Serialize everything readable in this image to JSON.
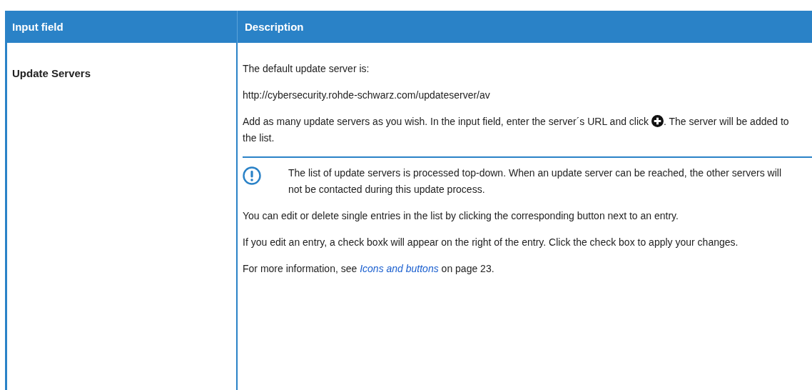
{
  "table": {
    "columns": [
      "Input field",
      "Description"
    ],
    "rows": [
      {
        "field": "Update Servers",
        "description": [
          {
            "kind": "paragraph",
            "text": "The default update server is:"
          },
          {
            "kind": "paragraph",
            "text": "http://cybersecurity.rohde-schwarz.com/updateserver/av"
          },
          {
            "kind": "icon_paragraph",
            "before": "Add as many update servers as you wish. In the input field, enter the server´s URL and click ",
            "after": ". The server will be added to the list."
          },
          {
            "kind": "note",
            "text": "The list of update servers is processed top-down. When an update server can be reached, the other servers will not be contacted during this update process."
          },
          {
            "kind": "paragraph",
            "text": "You can edit or delete single entries in the list by clicking the corresponding button next to an entry."
          },
          {
            "kind": "paragraph",
            "text": "If you edit an entry, a check boxk will appear on the right of the entry. Click the check box to apply your changes."
          },
          {
            "kind": "link_paragraph",
            "before": "For more information, see ",
            "link": "Icons and buttons",
            "after": " on page 23."
          }
        ]
      }
    ]
  }
}
